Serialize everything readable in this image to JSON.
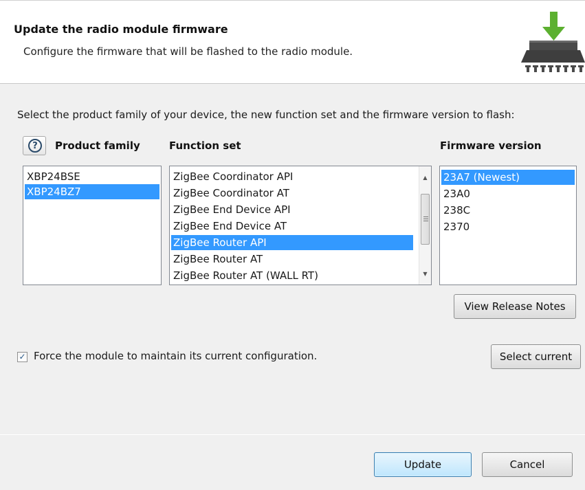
{
  "header": {
    "title": "Update the radio module firmware",
    "subtitle": "Configure the firmware that will be flashed to the radio module."
  },
  "instructions": "Select the product family of your device, the new function set and the firmware version to flash:",
  "columns": {
    "product_family": "Product family",
    "function_set": "Function set",
    "firmware_version": "Firmware version"
  },
  "product_family": {
    "items": [
      "XBP24BSE",
      "XBP24BZ7"
    ],
    "selected_index": 1
  },
  "function_set": {
    "items": [
      "ZigBee Coordinator API",
      "ZigBee Coordinator AT",
      "ZigBee End Device API",
      "ZigBee End Device AT",
      "ZigBee Router API",
      "ZigBee Router AT",
      "ZigBee Router AT (WALL RT)"
    ],
    "selected_index": 4
  },
  "firmware_version": {
    "items": [
      "23A7 (Newest)",
      "23A0",
      "238C",
      "2370"
    ],
    "selected_index": 0
  },
  "buttons": {
    "view_release_notes": "View Release Notes",
    "select_current": "Select current",
    "update": "Update",
    "cancel": "Cancel",
    "help_glyph": "?"
  },
  "checkbox": {
    "label": "Force the module to maintain its current configuration.",
    "checked": true,
    "glyph": "✓"
  },
  "colors": {
    "selection": "#3399ff",
    "arrow_green": "#5cb030"
  }
}
